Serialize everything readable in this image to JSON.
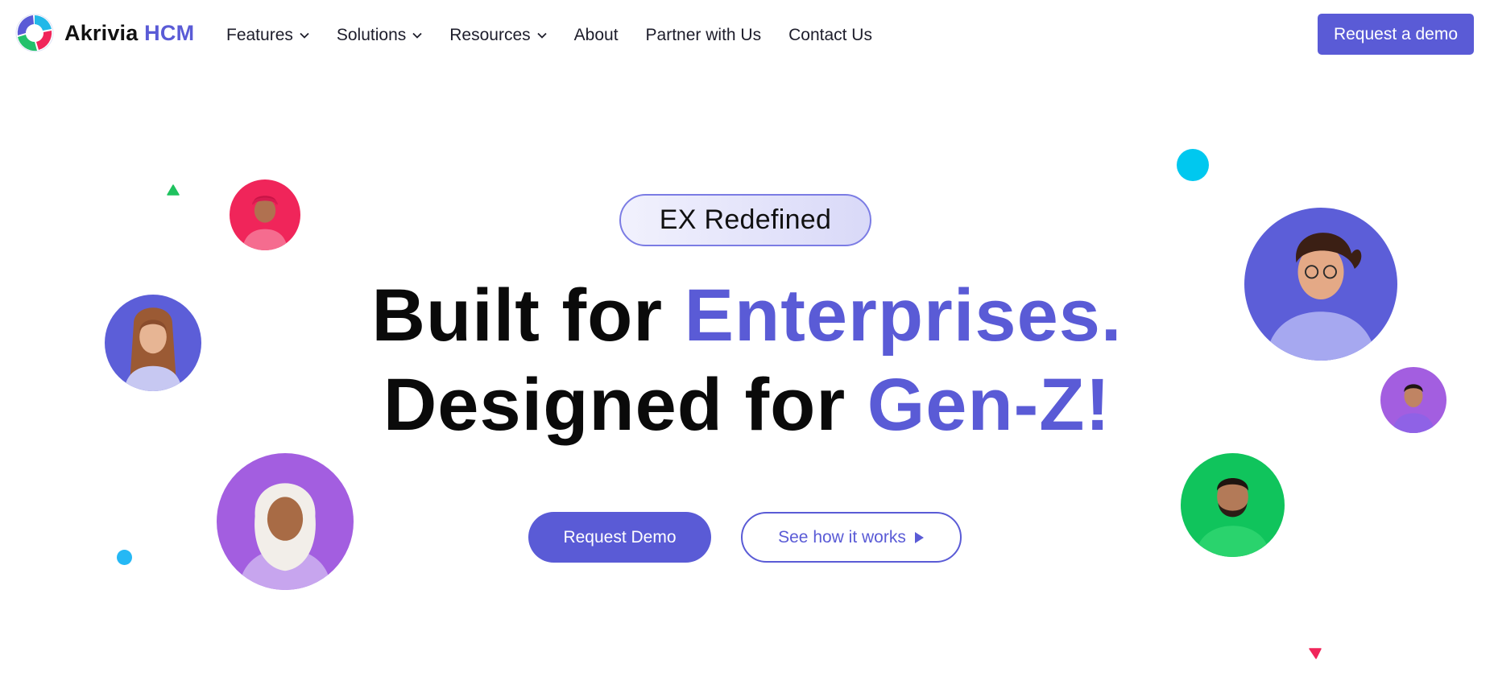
{
  "brand": {
    "name": "Akrivia",
    "accent": "HCM",
    "logo_icon": "akrivia-logo-icon"
  },
  "nav": {
    "items": [
      {
        "label": "Features",
        "has_dropdown": true
      },
      {
        "label": "Solutions",
        "has_dropdown": true
      },
      {
        "label": "Resources",
        "has_dropdown": true
      },
      {
        "label": "About",
        "has_dropdown": false
      },
      {
        "label": "Partner with Us",
        "has_dropdown": false
      },
      {
        "label": "Contact Us",
        "has_dropdown": false
      }
    ],
    "cta_label": "Request a demo"
  },
  "hero": {
    "badge": "EX Redefined",
    "line1_plain": "Built for ",
    "line1_accent": "Enterprises.",
    "line2_plain": "Designed for ",
    "line2_accent": "Gen-Z!",
    "primary_button": "Request Demo",
    "secondary_button": "See how it works"
  },
  "colors": {
    "brand": "#5a5bd6",
    "text": "#0a0a0a",
    "pink": "#f0255a",
    "purple": "#a35ee0",
    "indigo": "#5c5ed8",
    "green": "#10c45c",
    "cyan": "#00c8ef",
    "sky": "#25b8f5",
    "triangle_green": "#1fc25f",
    "triangle_pink": "#f0255a"
  },
  "icons": [
    "akrivia-logo-icon",
    "chevron-down-icon",
    "play-icon",
    "person-avatar"
  ]
}
